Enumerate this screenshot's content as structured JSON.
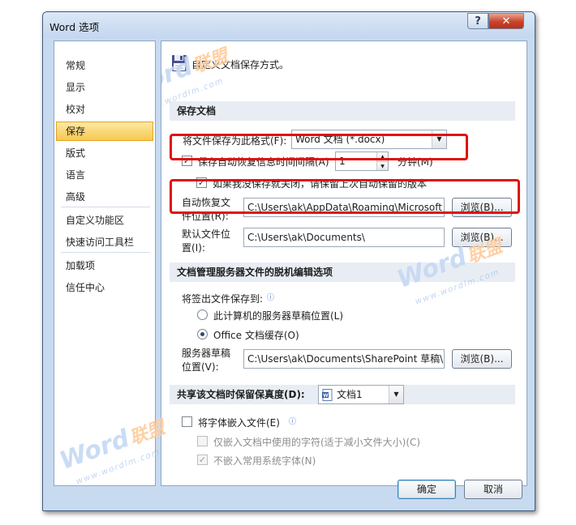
{
  "window": {
    "title": "Word 选项",
    "help_label": "?",
    "close_label": "✕"
  },
  "nav": {
    "items": [
      "常规",
      "显示",
      "校对",
      "保存",
      "版式",
      "语言",
      "高级",
      "自定义功能区",
      "快速访问工具栏",
      "加载项",
      "信任中心"
    ],
    "active_index": 3
  },
  "header": {
    "text": "自定义文档保存方式。"
  },
  "save_docs": {
    "section_title": "保存文档",
    "format_label": "将文件保存为此格式(F):",
    "format_value": "Word 文档 (*.docx)",
    "autorecover_label": "保存自动恢复信息时间间隔(A)",
    "autorecover_checked": true,
    "autorecover_minutes": "1",
    "minutes_unit": "分钟(M)",
    "keep_last_label": "如果我没保存就关闭，请保留上次自动保留的版本",
    "keep_last_checked": true,
    "ar_location_label_1": "自动恢复文",
    "ar_location_label_2": "件位置(R):",
    "ar_location_value": "C:\\Users\\ak\\AppData\\Roaming\\Microsoft",
    "default_location_label_1": "默认文件位",
    "default_location_label_2": "置(I):",
    "default_location_value": "C:\\Users\\ak\\Documents\\",
    "browse_label": "浏览(B)..."
  },
  "offline": {
    "section_title": "文档管理服务器文件的脱机编辑选项",
    "checkout_label": "将签出文件保存到:",
    "radio_server_label": "此计算机的服务器草稿位置(L)",
    "radio_office_label": "Office 文档缓存(O)",
    "selected": "office",
    "server_drafts_label_1": "服务器草稿",
    "server_drafts_label_2": "位置(V):",
    "server_drafts_value": "C:\\Users\\ak\\Documents\\SharePoint 草稿\\",
    "browse_label": "浏览(B)..."
  },
  "fidelity": {
    "section_title": "共享该文档时保留保真度(D):",
    "doc_value": "文档1",
    "embed_fonts_label": "将字体嵌入文件(E)",
    "embed_fonts_checked": false,
    "embed_used_only_label": "仅嵌入文档中使用的字符(适于减小文件大小)(C)",
    "embed_used_only_checked": false,
    "no_common_fonts_label": "不嵌入常用系统字体(N)",
    "no_common_fonts_checked": true
  },
  "footer": {
    "ok_label": "确定",
    "cancel_label": "取消"
  },
  "watermark": {
    "word": "Word",
    "cn": "联盟",
    "url": "www.wordlm.com"
  },
  "colors": {
    "highlight_red": "#e01010",
    "nav_active": "#f6c94e",
    "window_frame": "#c8daf0"
  }
}
